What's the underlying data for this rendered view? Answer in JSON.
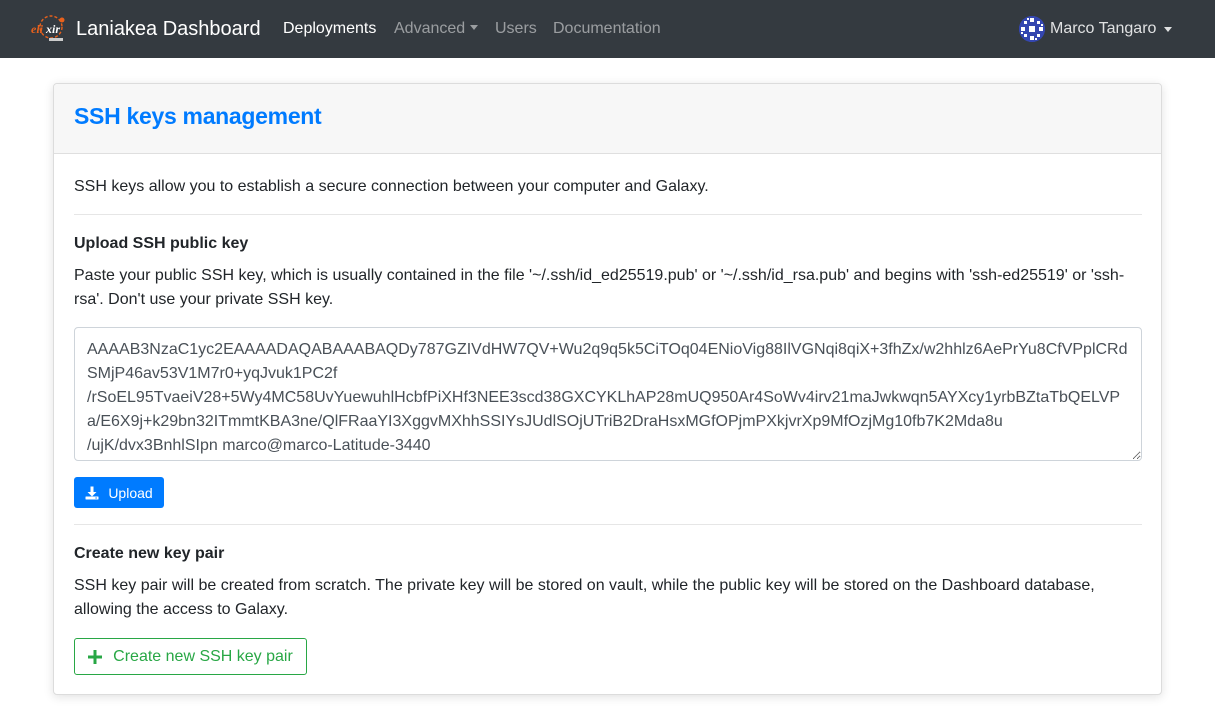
{
  "navbar": {
    "brand_logo_text": "elixir",
    "brand_name": "Laniakea Dashboard",
    "links": [
      {
        "label": "Deployments"
      },
      {
        "label": "Advanced"
      },
      {
        "label": "Users"
      },
      {
        "label": "Documentation"
      }
    ],
    "user_name": "Marco Tangaro"
  },
  "card": {
    "title": "SSH keys management",
    "intro": "SSH keys allow you to establish a secure connection between your computer and Galaxy.",
    "upload": {
      "title": "Upload SSH public key",
      "description": "Paste your public SSH key, which is usually contained in the file '~/.ssh/id_ed25519.pub' or '~/.ssh/id_rsa.pub' and begins with 'ssh-ed25519' or 'ssh-rsa'. Don't use your private SSH key.",
      "key_value": "AAAAB3NzaC1yc2EAAAADAQABAAABAQDy787GZIVdHW7QV+Wu2q9q5k5CiTOq04ENioVig88IlVGNqi8qiX+3fhZx/w2hhlz6AePrYu8CfVPplCRdSMjP46av53V1M7r0+yqJvuk1PC2f\n/rSoEL95TvaeiV28+5Wy4MC58UvYuewuhlHcbfPiXHf3NEE3scd38GXCYKLhAP28mUQ950Ar4SoWv4irv21maJwkwqn5AYXcy1yrbBZtaTbQELVPa/E6X9j+k29bn32ITmmtKBA3ne/QlFRaaYI3XggvMXhhSSIYsJUdlSOjUTriB2DraHsxMGfOPjmPXkjvrXp9MfOzjMg10fb7K2Mda8u\n/ujK/dvx3BnhlSIpn marco@marco-Latitude-3440",
      "button_label": "Upload"
    },
    "create": {
      "title": "Create new key pair",
      "description": "SSH key pair will be created from scratch. The private key will be stored on vault, while the public key will be stored on the Dashboard database, allowing the access to Galaxy.",
      "button_label": "Create new SSH key pair"
    }
  },
  "colors": {
    "navbar_bg": "#343a40",
    "primary": "#007bff",
    "success": "#28a745"
  },
  "icons": {
    "upload_button": "download-icon",
    "create_button": "plus-icon"
  }
}
